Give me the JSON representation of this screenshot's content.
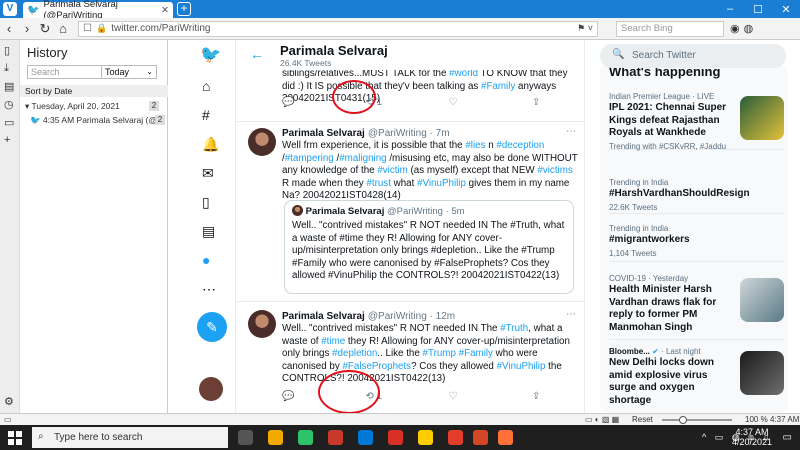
{
  "browser": {
    "tab_title": "Parimala Selvaraj (@PariWriting",
    "url": "twitter.com/PariWriting",
    "search_placeholder": "Search Bing"
  },
  "history": {
    "title": "History",
    "search_placeholder": "Search",
    "range": "Today",
    "sort_label": "Sort by Date",
    "day_label": "Tuesday, April 20, 2021",
    "day_count": "2",
    "entry_time": "4:35 AM",
    "entry_title": "Parimala Selvaraj (@...",
    "entry_count": "2"
  },
  "profile": {
    "name": "Parimala Selvaraj",
    "tweet_count": "26.4K Tweets"
  },
  "tweets": [
    {
      "text_a": "siblings/relatives...MUST TALK for the ",
      "tag_a": "#world",
      "text_b": " TO KNOW that they did :) It IS possible that they'v been talking as ",
      "tag_b": "#Family",
      "text_c": " anyways 20042021IST0431(15)",
      "retweets": "1"
    },
    {
      "name": "Parimala Selvaraj",
      "handle": "@PariWriting · 7m",
      "p1": "Well frm experience, it is possible that the ",
      "t1": "#lies",
      "p2": " n ",
      "t2": "#deception",
      "p3": " /",
      "t3": "#tampering",
      "p4": " /",
      "t4": "#maligning",
      "p5": " /misusing etc, may also be done WITHOUT any knowledge of the ",
      "t5": "#victim",
      "p6": " (as myself) except that NEW ",
      "t6": "#victims",
      "p7": " R made when they ",
      "t7": "#trust",
      "p8": " what ",
      "t8": "#VinuPhilip",
      "p9": " gives them in my name Na? 20042021IST0428(14)",
      "quote_name": "Parimala Selvaraj",
      "quote_handle": "@PariWriting · 5m",
      "quote_text": "Well.. \"contrived mistakes\" R NOT needed IN The #Truth, what a waste of #time they R! Allowing for ANY cover-up/misinterpretation only brings #depletion.. Like the #Trump #Family who were canonised by #FalseProphets? Cos they allowed #VinuPhilip the CONTROLS?! 20042021IST0422(13)"
    },
    {
      "name": "Parimala Selvaraj",
      "handle": "@PariWriting · 12m",
      "p1": "Well.. \"contrived mistakes\" R NOT needed IN The ",
      "t1": "#Truth",
      "p2": ", what a waste of ",
      "t2": "#time",
      "p3": " they R! Allowing for ANY cover-up/misinterpretation only brings ",
      "t3": "#depletion",
      "p4": ".. Like the ",
      "t4": "#Trump",
      "p5": " ",
      "t5": "#Family",
      "p6": " who were canonised by ",
      "t6": "#FalseProphets",
      "p7": "? Cos they allowed ",
      "t7": "#VinuPhilip",
      "p8": " the CONTROLS?! 20042021IST0422(13)",
      "retweets": "1"
    }
  ],
  "right": {
    "search_placeholder": "Search Twitter",
    "whats_happening": "What's happening",
    "trends": [
      {
        "meta": "Indian Premier League · LIVE",
        "title": "IPL 2021: Chennai Super Kings defeat Rajasthan Royals at Wankhede",
        "sub": "Trending with #CSKvRR, #Jaddu"
      },
      {
        "meta": "Trending in India",
        "title": "#HarshVardhanShouldResign",
        "sub": "22.6K Tweets"
      },
      {
        "meta": "Trending in India",
        "title": "#migrantworkers",
        "sub": "1,104 Tweets"
      },
      {
        "meta": "COVID-19 · Yesterday",
        "title": "Health Minister Harsh Vardhan draws flak for reply to former PM Manmohan Singh",
        "sub": ""
      },
      {
        "meta": "Bloombe...",
        "meta2": "· Last night",
        "title": "New Delhi locks down amid explosive virus surge and oxygen shortage",
        "sub": ""
      }
    ]
  },
  "statusbar": {
    "reset": "Reset",
    "zoom": "100 %",
    "time": "4:37 AM",
    "zoom_level": 0.3
  },
  "taskbar": {
    "search_placeholder": "Type here to search",
    "time": "4:37 AM",
    "date": "4/20/2021"
  },
  "colors": {
    "twitter_blue": "#1da1f2",
    "vivaldi_blue": "#1a7fd4",
    "annotation_red": "#e0121b"
  }
}
